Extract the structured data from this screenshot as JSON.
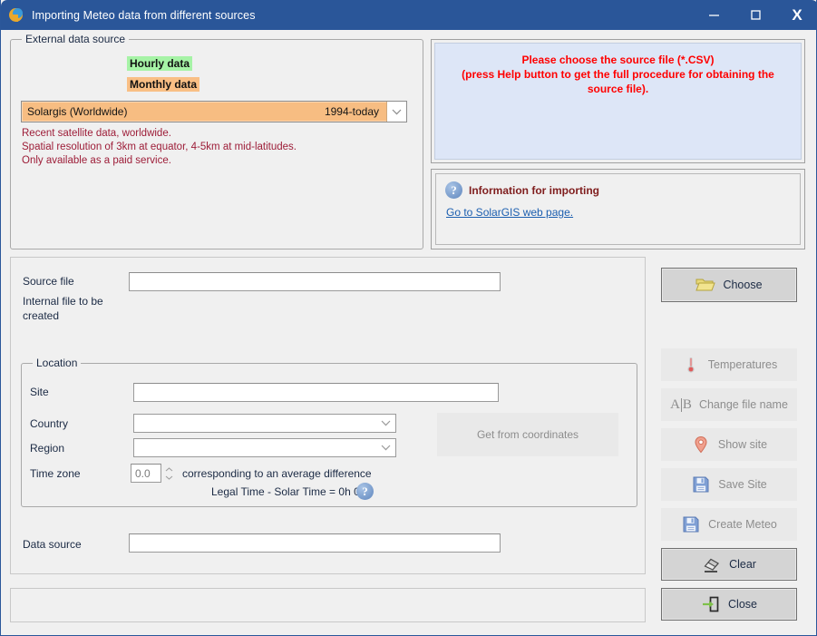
{
  "window": {
    "title": "Importing Meteo data from different sources",
    "icon": "globe-icon",
    "minimize_label": "—",
    "maximize_label": "□",
    "close_label": "X"
  },
  "external_data_source": {
    "group_title": "External data source",
    "tags": [
      {
        "label": "Hourly data",
        "color": "#a6f3a6"
      },
      {
        "label": "Monthly data",
        "color": "#f9bf85"
      }
    ],
    "source_combo": {
      "value": "Solargis (Worldwide)",
      "years": "1994-today",
      "bg_color": "#f7bd82"
    },
    "description": "Recent satellite data, worldwide.\nSpatial resolution of 3km at equator, 4-5km at mid-latitudes.\nOnly available as a paid service.",
    "description_color": "#9d1d38"
  },
  "message_panel": {
    "text": "Please choose the source file (*.CSV)\n(press Help button to get the full procedure for obtaining the source file).",
    "text_color": "#ff0000",
    "bg_color": "#dde6f7"
  },
  "info_panel": {
    "icon": "question-icon",
    "heading": "Information for importing",
    "heading_color": "#7f1d1d",
    "link": "Go to SolarGIS web page.",
    "link_color": "#1c5fb0"
  },
  "form": {
    "source_file_label": "Source file",
    "source_file_value": "",
    "internal_file_label": "Internal file to be\ncreated",
    "data_source_label": "Data source",
    "data_source_value": "",
    "status_text": ""
  },
  "location": {
    "group_title": "Location",
    "site_label": "Site",
    "site_value": "",
    "country_label": "Country",
    "country_value": "",
    "region_label": "Region",
    "region_value": "",
    "timezone_label": "Time zone",
    "timezone_value": "0.0",
    "corresponding_text": "corresponding to an average difference",
    "legal_time_text": "Legal Time - Solar Time =   0h  0m",
    "help_icon": "question-icon",
    "get_from_coordinates_label": "Get from coordinates"
  },
  "buttons": [
    {
      "name": "choose",
      "label": "Choose",
      "icon": "folder-open-icon",
      "enabled": true
    },
    {
      "name": "temperatures",
      "label": "Temperatures",
      "icon": "thermometer-icon",
      "enabled": false
    },
    {
      "name": "rename",
      "label": "Change file name",
      "icon": "ab-text-icon",
      "enabled": false
    },
    {
      "name": "showsite",
      "label": "Show site",
      "icon": "map-pin-icon",
      "enabled": false
    },
    {
      "name": "savesite",
      "label": "Save Site",
      "icon": "floppy-disk-icon",
      "enabled": false
    },
    {
      "name": "createmeteo",
      "label": "Create Meteo",
      "icon": "floppy-disk-icon",
      "enabled": false
    },
    {
      "name": "clear",
      "label": "Clear",
      "icon": "eraser-icon",
      "enabled": true
    },
    {
      "name": "close",
      "label": "Close",
      "icon": "exit-door-icon",
      "enabled": true
    }
  ]
}
